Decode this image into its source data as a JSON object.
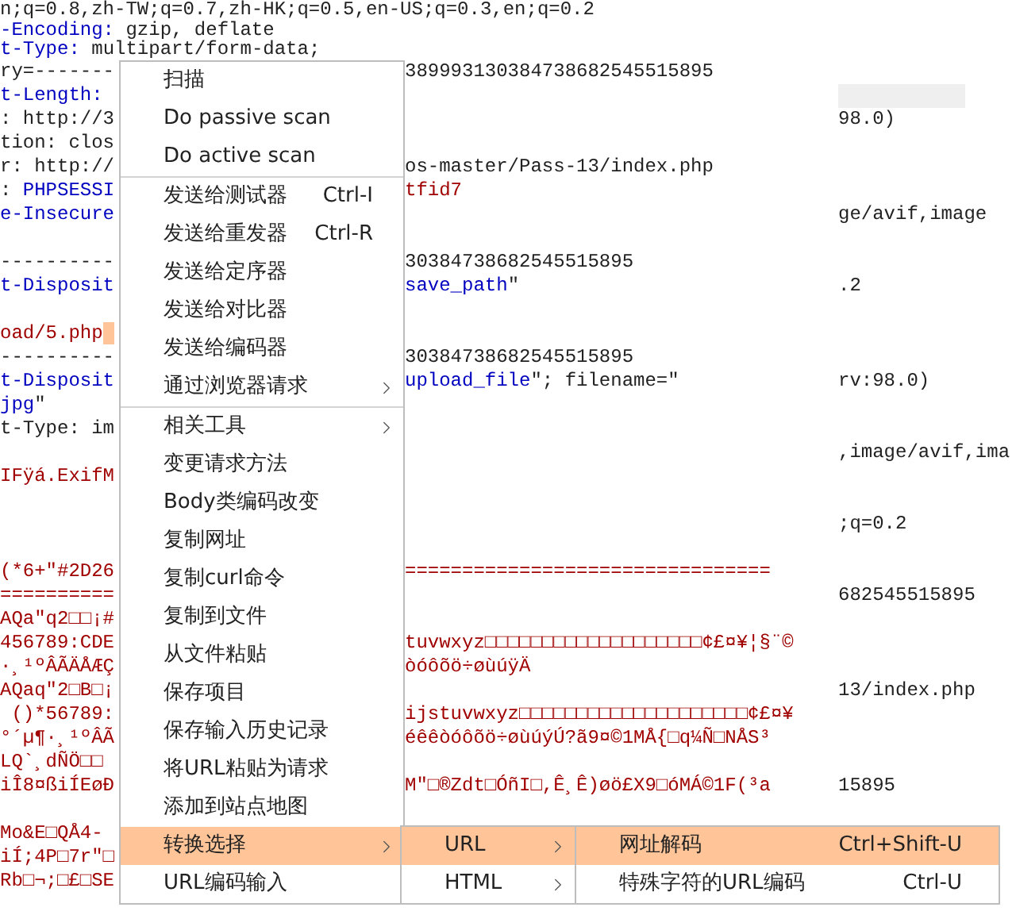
{
  "editor": {
    "lines": [
      {
        "kind": "text",
        "full": [
          {
            "text": "n;q=0.8,zh-TW;q=0.7,zh-HK;q=0.5,en-US;q=0.3,en;q=0.2",
            "kind": "plain"
          }
        ]
      },
      {
        "kind": "text",
        "full": [
          {
            "text": "-Encoding:",
            "kind": "key"
          },
          {
            "text": " gzip, deflate",
            "kind": "plain"
          }
        ]
      },
      {
        "kind": "text",
        "full": [
          {
            "text": "t-Type:",
            "kind": "key"
          },
          {
            "text": " multipart/form-data;",
            "kind": "plain"
          }
        ]
      },
      {
        "kind": "text",
        "left": [
          {
            "text": "ry=-------",
            "kind": "plain"
          }
        ],
        "middle": [
          {
            "text": "389993130384738682545515895",
            "kind": "plain"
          }
        ]
      },
      {
        "kind": "text",
        "left": [
          {
            "text": "t-Length:",
            "kind": "key"
          }
        ],
        "right_highlight": true
      },
      {
        "kind": "text",
        "left": [
          {
            "text": ": http://3",
            "kind": "plain"
          }
        ],
        "right": [
          {
            "text": "98.0)",
            "kind": "plain"
          }
        ]
      },
      {
        "kind": "text",
        "left": [
          {
            "text": "tion: clos",
            "kind": "plain"
          }
        ]
      },
      {
        "kind": "text",
        "left": [
          {
            "text": "r: http://",
            "kind": "plain"
          }
        ],
        "middle": [
          {
            "text": "os-master/Pass-13/index.php",
            "kind": "plain"
          }
        ]
      },
      {
        "kind": "text",
        "left": [
          {
            "text": ": ",
            "kind": "plain"
          },
          {
            "text": "PHPSESSI",
            "kind": "key"
          }
        ],
        "middle": [
          {
            "text": "tfid7",
            "kind": "data"
          }
        ]
      },
      {
        "kind": "text",
        "left": [
          {
            "text": "e-Insecure",
            "kind": "key"
          }
        ],
        "right": [
          {
            "text": "ge/avif,image",
            "kind": "plain"
          }
        ]
      },
      {
        "kind": "blank"
      },
      {
        "kind": "text",
        "left": [
          {
            "text": "----------",
            "kind": "plain"
          }
        ],
        "middle": [
          {
            "text": "30384738682545515895",
            "kind": "plain"
          }
        ]
      },
      {
        "kind": "text",
        "left": [
          {
            "text": "t-Disposit",
            "kind": "key"
          }
        ],
        "middle": [
          {
            "text": "save_path",
            "kind": "key"
          },
          {
            "text": "\"",
            "kind": "plain"
          }
        ],
        "right": [
          {
            "text": ".2",
            "kind": "plain"
          }
        ]
      },
      {
        "kind": "blank"
      },
      {
        "kind": "text",
        "left": [
          {
            "text": "oad/5.php",
            "kind": "data"
          }
        ],
        "selection": true
      },
      {
        "kind": "text",
        "left": [
          {
            "text": "----------",
            "kind": "plain"
          }
        ],
        "middle": [
          {
            "text": "30384738682545515895",
            "kind": "plain"
          }
        ]
      },
      {
        "kind": "text",
        "left": [
          {
            "text": "t-Disposit",
            "kind": "key"
          }
        ],
        "middle": [
          {
            "text": "upload_file",
            "kind": "key"
          },
          {
            "text": "\"; filename=\"",
            "kind": "plain"
          }
        ],
        "right": [
          {
            "text": "rv:98.0)",
            "kind": "plain"
          }
        ]
      },
      {
        "kind": "text",
        "left": [
          {
            "text": "jpg",
            "kind": "key"
          },
          {
            "text": "\"",
            "kind": "plain"
          }
        ]
      },
      {
        "kind": "text",
        "left": [
          {
            "text": "t-Type: im",
            "kind": "plain"
          }
        ]
      },
      {
        "kind": "text",
        "right": [
          {
            "text": ",image/avif,ima",
            "kind": "plain"
          }
        ]
      },
      {
        "kind": "text",
        "left": [
          {
            "text": "IFÿá.ExifM",
            "kind": "data"
          }
        ]
      },
      {
        "kind": "blank"
      },
      {
        "kind": "text",
        "right": [
          {
            "text": ";q=0.2",
            "kind": "plain"
          }
        ]
      },
      {
        "kind": "blank"
      },
      {
        "kind": "text",
        "left": [
          {
            "text": "(*6+\"#2D26",
            "kind": "data"
          }
        ],
        "middle": [
          {
            "text": "================================",
            "kind": "data"
          }
        ]
      },
      {
        "kind": "text",
        "left": [
          {
            "text": "==========",
            "kind": "data"
          }
        ],
        "right": [
          {
            "text": "682545515895",
            "kind": "plain"
          }
        ]
      },
      {
        "kind": "text",
        "left": [
          {
            "text": "AQa\"q2□□¡#",
            "kind": "data"
          }
        ]
      },
      {
        "kind": "text",
        "left": [
          {
            "text": "456789:CDE",
            "kind": "data"
          }
        ],
        "middle": [
          {
            "text": "tuvwxyz□□□□□□□□□□□□□□□□□□□¢£¤¥¦§¨©",
            "kind": "data"
          }
        ]
      },
      {
        "kind": "text",
        "left": [
          {
            "text": "·¸¹ºÂÃÄÅÆÇ",
            "kind": "data"
          }
        ],
        "middle": [
          {
            "text": "òóôõö÷øùúÿÄ",
            "kind": "data"
          }
        ]
      },
      {
        "kind": "text",
        "left": [
          {
            "text": "AQaq\"2□B□¡",
            "kind": "data"
          }
        ],
        "right": [
          {
            "text": "13/index.php",
            "kind": "plain"
          }
        ]
      },
      {
        "kind": "text",
        "left": [
          {
            "text": " ()*56789:",
            "kind": "data"
          }
        ],
        "middle": [
          {
            "text": "ijstuvwxyz□□□□□□□□□□□□□□□□□□□□¢£¤¥",
            "kind": "data"
          }
        ]
      },
      {
        "kind": "text",
        "left": [
          {
            "text": "°´µ¶·¸¹ºÂÃ",
            "kind": "data"
          }
        ],
        "middle": [
          {
            "text": "éêêòóôõö÷øùúýÚ?ã9¤©1MÅ{□q¼Ñ□NÅS³",
            "kind": "data"
          }
        ]
      },
      {
        "kind": "text",
        "left": [
          {
            "text": "LQ`¸dÑÖ□□",
            "kind": "data"
          }
        ]
      },
      {
        "kind": "text",
        "left": [
          {
            "text": "iÎ8¤ßiÍEøÐ",
            "kind": "data"
          }
        ],
        "middle": [
          {
            "text": "M\"□®Zdt□ÓñI□,Ê¸Ê)øö£X9□óMÁ©1F(³a",
            "kind": "data"
          }
        ],
        "right": [
          {
            "text": "15895",
            "kind": "plain"
          }
        ]
      },
      {
        "kind": "blank"
      },
      {
        "kind": "text",
        "left": [
          {
            "text": "Mo&E□QÅ4-",
            "kind": "data"
          }
        ]
      },
      {
        "kind": "text",
        "left": [
          {
            "text": "iÍ;4P□7r\"□",
            "kind": "data"
          }
        ]
      },
      {
        "kind": "text",
        "left": [
          {
            "text": "Rb□¬;□£□SE",
            "kind": "data"
          }
        ]
      }
    ]
  },
  "context_menu": {
    "items": [
      {
        "kind": "item",
        "label": "扫描",
        "selected": false
      },
      {
        "kind": "item",
        "label": "Do passive scan",
        "selected": false
      },
      {
        "kind": "item",
        "label": "Do active scan",
        "selected": false
      },
      {
        "kind": "separator"
      },
      {
        "kind": "item",
        "label": "发送给测试器",
        "shortcut": "Ctrl-I",
        "selected": false
      },
      {
        "kind": "item",
        "label": "发送给重发器",
        "shortcut": "Ctrl-R",
        "selected": false
      },
      {
        "kind": "item",
        "label": "发送给定序器",
        "selected": false
      },
      {
        "kind": "item",
        "label": "发送给对比器",
        "selected": false
      },
      {
        "kind": "item",
        "label": "发送给编码器",
        "selected": false
      },
      {
        "kind": "item",
        "label": "通过浏览器请求",
        "submenu": true,
        "selected": false
      },
      {
        "kind": "separator"
      },
      {
        "kind": "item",
        "label": "相关工具",
        "submenu": true,
        "selected": false
      },
      {
        "kind": "item",
        "label": "变更请求方法",
        "selected": false
      },
      {
        "kind": "item",
        "label": "Body类编码改变",
        "selected": false
      },
      {
        "kind": "item",
        "label": "复制网址",
        "selected": false
      },
      {
        "kind": "item",
        "label": "复制curl命令",
        "selected": false
      },
      {
        "kind": "item",
        "label": "复制到文件",
        "selected": false
      },
      {
        "kind": "item",
        "label": "从文件粘贴",
        "selected": false
      },
      {
        "kind": "item",
        "label": "保存项目",
        "selected": false
      },
      {
        "kind": "item",
        "label": "保存输入历史记录",
        "selected": false
      },
      {
        "kind": "item",
        "label": "将URL粘贴为请求",
        "selected": false
      },
      {
        "kind": "item",
        "label": "添加到站点地图",
        "selected": false
      },
      {
        "kind": "item",
        "label": "转换选择",
        "submenu": true,
        "selected": true
      },
      {
        "kind": "item",
        "label": "URL编码输入",
        "selected": false
      }
    ]
  },
  "submenu": {
    "items": [
      {
        "kind": "item",
        "label": "URL",
        "submenu": true,
        "selected": true
      },
      {
        "kind": "item",
        "label": "HTML",
        "submenu": true,
        "selected": false
      }
    ]
  },
  "sub_submenu": {
    "items": [
      {
        "kind": "item",
        "label": "网址解码",
        "shortcut": "Ctrl+Shift-U",
        "selected": true
      },
      {
        "kind": "item",
        "label": "特殊字符的URL编码",
        "shortcut": "Ctrl-U",
        "selected": false
      }
    ]
  }
}
